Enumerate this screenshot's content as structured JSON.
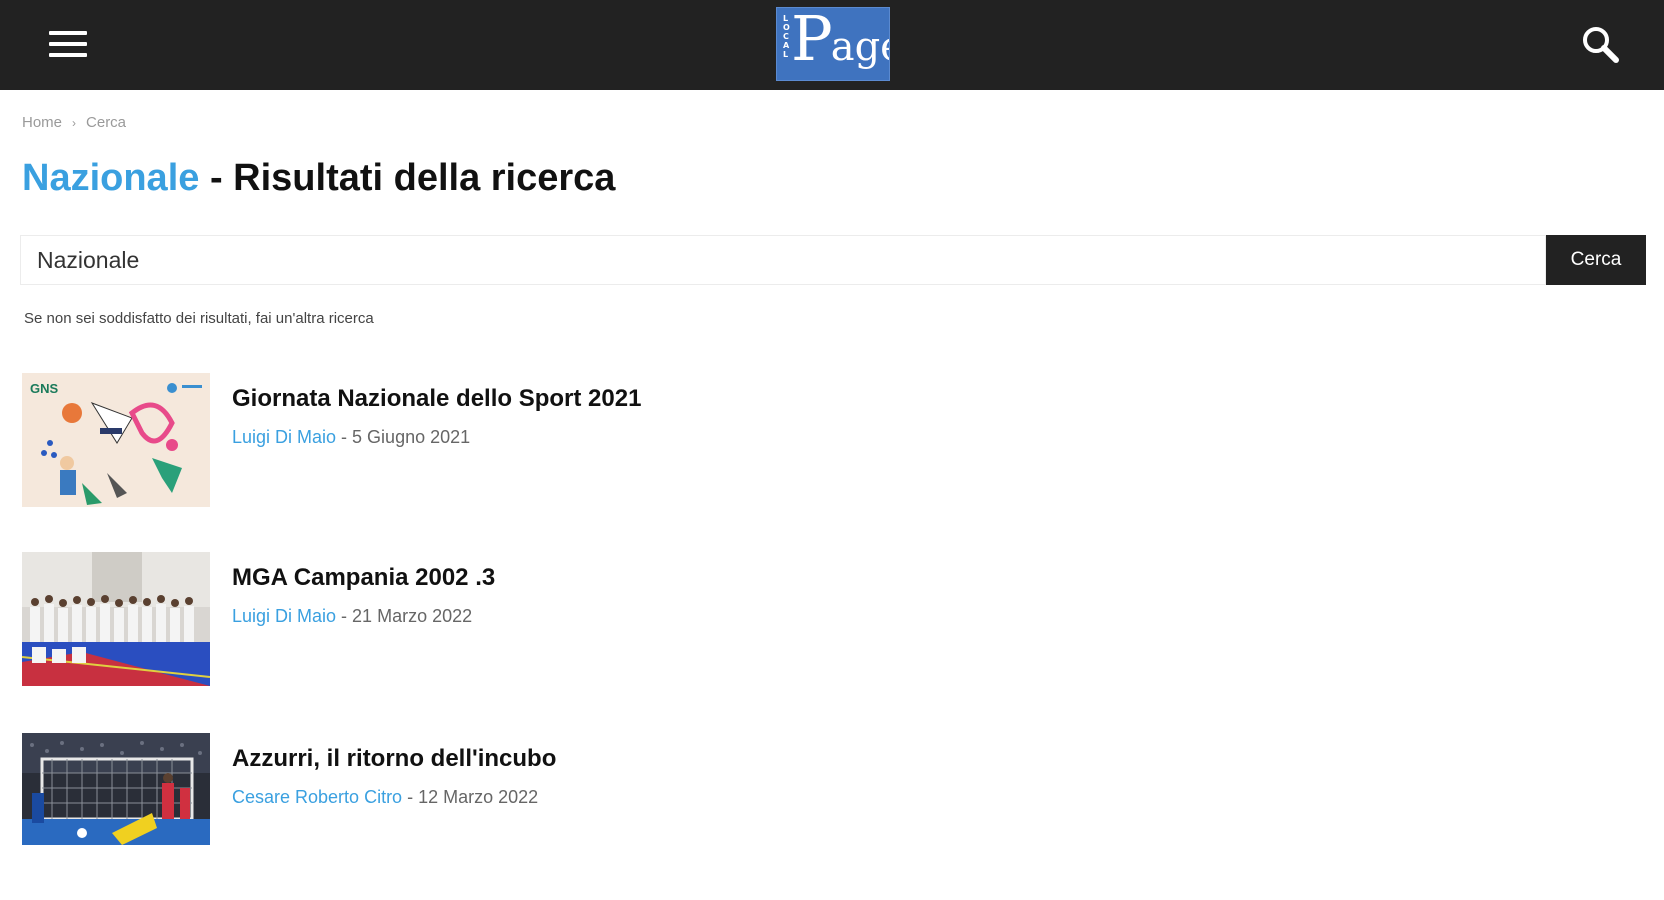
{
  "header": {
    "logo_side": "LOCAL",
    "logo_big": "P",
    "logo_small": "age",
    "menu_icon": "hamburger-menu-icon",
    "search_icon": "search-icon",
    "background": "#222222",
    "logo_color": "#3f73bf"
  },
  "breadcrumb": {
    "home": "Home",
    "separator": "›",
    "current": "Cerca"
  },
  "title": {
    "highlight": "Nazionale",
    "rest": " - Risultati della ricerca",
    "accent_color": "#3aa0e0"
  },
  "search": {
    "value": "Nazionale",
    "button_label": "Cerca"
  },
  "hint": "Se non sei soddisfatto dei risultati, fai un'altra ricerca",
  "results": [
    {
      "title": "Giornata Nazionale dello Sport 2021",
      "author": "Luigi Di Maio",
      "separator": " - ",
      "date": "5 Giugno 2021",
      "thumb_label": "GNS"
    },
    {
      "title": "MGA Campania 2002 .3",
      "author": "Luigi Di Maio",
      "separator": " - ",
      "date": "21 Marzo 2022"
    },
    {
      "title": "Azzurri, il ritorno dell'incubo",
      "author": "Cesare Roberto Citro",
      "separator": " - ",
      "date": "12 Marzo 2022"
    }
  ]
}
